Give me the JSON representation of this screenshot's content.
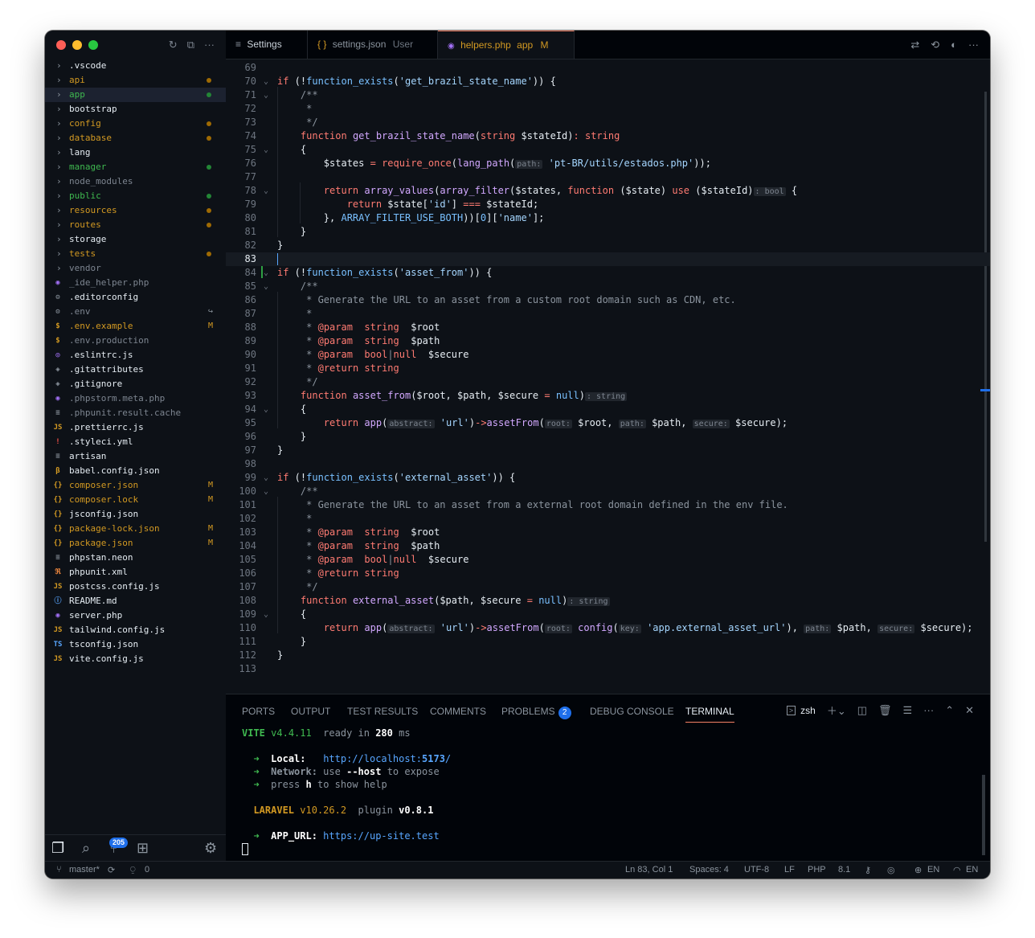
{
  "tabs": [
    {
      "icon": "≡",
      "label": "Settings",
      "desc": ""
    },
    {
      "icon": "{ }",
      "label": "settings.json",
      "desc": "User"
    },
    {
      "icon": "php",
      "label": "helpers.php",
      "desc": "app",
      "status": "M"
    }
  ],
  "sidebar": {
    "items": [
      {
        "label": ".vscode",
        "type": "folder",
        "color": "#e6edf3",
        "mark": ""
      },
      {
        "label": "api",
        "type": "folder",
        "color": "#d29922",
        "mark": "dot-yellow"
      },
      {
        "label": "app",
        "type": "folder",
        "color": "#3fb950",
        "mark": "dot-green",
        "selected": true
      },
      {
        "label": "bootstrap",
        "type": "folder",
        "color": "#e6edf3",
        "mark": ""
      },
      {
        "label": "config",
        "type": "folder",
        "color": "#d29922",
        "mark": "dot-yellow"
      },
      {
        "label": "database",
        "type": "folder",
        "color": "#d29922",
        "mark": "dot-yellow"
      },
      {
        "label": "lang",
        "type": "folder",
        "color": "#e6edf3",
        "mark": ""
      },
      {
        "label": "manager",
        "type": "folder",
        "color": "#3fb950",
        "mark": "dot-green"
      },
      {
        "label": "node_modules",
        "type": "folder",
        "color": "#7d8590",
        "mark": ""
      },
      {
        "label": "public",
        "type": "folder",
        "color": "#3fb950",
        "mark": "dot-green"
      },
      {
        "label": "resources",
        "type": "folder",
        "color": "#d29922",
        "mark": "dot-yellow"
      },
      {
        "label": "routes",
        "type": "folder",
        "color": "#d29922",
        "mark": "dot-yellow"
      },
      {
        "label": "storage",
        "type": "folder",
        "color": "#e6edf3",
        "mark": ""
      },
      {
        "label": "tests",
        "type": "folder",
        "color": "#d29922",
        "mark": "dot-yellow"
      },
      {
        "label": "vendor",
        "type": "folder",
        "color": "#7d8590",
        "mark": ""
      },
      {
        "label": "_ide_helper.php",
        "type": "file",
        "icon": "php",
        "color": "#7d8590",
        "mark": ""
      },
      {
        "label": ".editorconfig",
        "type": "file",
        "icon": "gear",
        "color": "#e6edf3",
        "mark": ""
      },
      {
        "label": ".env",
        "type": "file",
        "icon": "gear",
        "color": "#7d8590",
        "mark": "arrow"
      },
      {
        "label": ".env.example",
        "type": "file",
        "icon": "$",
        "color": "#d29922",
        "mark": "M"
      },
      {
        "label": ".env.production",
        "type": "file",
        "icon": "$",
        "color": "#7d8590",
        "mark": ""
      },
      {
        "label": ".eslintrc.js",
        "type": "file",
        "icon": "eslint",
        "color": "#e6edf3",
        "mark": ""
      },
      {
        "label": ".gitattributes",
        "type": "file",
        "icon": "git",
        "color": "#e6edf3",
        "mark": ""
      },
      {
        "label": ".gitignore",
        "type": "file",
        "icon": "git",
        "color": "#e6edf3",
        "mark": ""
      },
      {
        "label": ".phpstorm.meta.php",
        "type": "file",
        "icon": "php",
        "color": "#7d8590",
        "mark": ""
      },
      {
        "label": ".phpunit.result.cache",
        "type": "file",
        "icon": "lines",
        "color": "#7d8590",
        "mark": ""
      },
      {
        "label": ".prettierrc.js",
        "type": "file",
        "icon": "JS",
        "color": "#e6edf3",
        "mark": ""
      },
      {
        "label": ".styleci.yml",
        "type": "file",
        "icon": "!",
        "color": "#e6edf3",
        "mark": ""
      },
      {
        "label": "artisan",
        "type": "file",
        "icon": "lines",
        "color": "#e6edf3",
        "mark": ""
      },
      {
        "label": "babel.config.json",
        "type": "file",
        "icon": "babel",
        "color": "#e6edf3",
        "mark": ""
      },
      {
        "label": "composer.json",
        "type": "file",
        "icon": "{}",
        "color": "#d29922",
        "mark": "M"
      },
      {
        "label": "composer.lock",
        "type": "file",
        "icon": "{}",
        "color": "#d29922",
        "mark": "M"
      },
      {
        "label": "jsconfig.json",
        "type": "file",
        "icon": "{}",
        "color": "#e6edf3",
        "mark": ""
      },
      {
        "label": "package-lock.json",
        "type": "file",
        "icon": "{}",
        "color": "#d29922",
        "mark": "M"
      },
      {
        "label": "package.json",
        "type": "file",
        "icon": "{}",
        "color": "#d29922",
        "mark": "M"
      },
      {
        "label": "phpstan.neon",
        "type": "file",
        "icon": "lines",
        "color": "#e6edf3",
        "mark": ""
      },
      {
        "label": "phpunit.xml",
        "type": "file",
        "icon": "rss",
        "color": "#e6edf3",
        "mark": ""
      },
      {
        "label": "postcss.config.js",
        "type": "file",
        "icon": "JS",
        "color": "#e6edf3",
        "mark": ""
      },
      {
        "label": "README.md",
        "type": "file",
        "icon": "info",
        "color": "#e6edf3",
        "mark": ""
      },
      {
        "label": "server.php",
        "type": "file",
        "icon": "php",
        "color": "#e6edf3",
        "mark": ""
      },
      {
        "label": "tailwind.config.js",
        "type": "file",
        "icon": "JS",
        "color": "#e6edf3",
        "mark": ""
      },
      {
        "label": "tsconfig.json",
        "type": "file",
        "icon": "TS",
        "color": "#e6edf3",
        "mark": ""
      },
      {
        "label": "vite.config.js",
        "type": "file",
        "icon": "JS",
        "color": "#e6edf3",
        "mark": ""
      }
    ],
    "scm_badge": "205"
  },
  "editor": {
    "current_line": 83,
    "lines": [
      {
        "n": 69,
        "html": ""
      },
      {
        "n": 70,
        "fold": true,
        "html": "<span class='kw'>if</span> (!<span class='ct'>function_exists</span>(<span class='st'>'get_brazil_state_name'</span>)) {"
      },
      {
        "n": 71,
        "fold": true,
        "html": "    <span class='cm'>/**</span>"
      },
      {
        "n": 72,
        "html": "    <span class='cm'> *</span>"
      },
      {
        "n": 73,
        "html": "    <span class='cm'> */</span>"
      },
      {
        "n": 74,
        "html": "    <span class='kw'>function</span> <span class='fn'>get_brazil_state_name</span>(<span class='kw'>string</span> <span class='pl'>$stateId</span>)<span class='kw'>:</span> <span class='kw'>string</span>"
      },
      {
        "n": 75,
        "fold": true,
        "html": "    {"
      },
      {
        "n": 76,
        "html": "        <span class='pl'>$states</span> <span class='kw'>=</span> <span class='kw'>require_once</span>(<span class='fn'>lang_path</span>(<span class='hint'>path:</span> <span class='st'>'pt-BR/utils/estados.php'</span>));"
      },
      {
        "n": 77,
        "html": ""
      },
      {
        "n": 78,
        "fold": true,
        "html": "        <span class='kw'>return</span> <span class='fn'>array_values</span>(<span class='fn'>array_filter</span>(<span class='pl'>$states</span>, <span class='kw'>function</span> (<span class='pl'>$state</span>) <span class='kw'>use</span> (<span class='pl'>$stateId</span>)<span class='hint'>: bool</span> {"
      },
      {
        "n": 79,
        "html": "            <span class='kw'>return</span> <span class='pl'>$state</span>[<span class='st'>'id'</span>] <span class='kw'>===</span> <span class='pl'>$stateId</span>;"
      },
      {
        "n": 80,
        "html": "        }, <span class='ct'>ARRAY_FILTER_USE_BOTH</span>))[<span class='ct'>0</span>][<span class='st'>'name'</span>];"
      },
      {
        "n": 81,
        "html": "    }"
      },
      {
        "n": 82,
        "html": "}"
      },
      {
        "n": 83,
        "html": ""
      },
      {
        "n": 84,
        "fold": true,
        "html": "<span class='kw'>if</span> (!<span class='ct'>function_exists</span>(<span class='st'>'asset_from'</span>)) {"
      },
      {
        "n": 85,
        "fold": true,
        "html": "    <span class='cm'>/**</span>"
      },
      {
        "n": 86,
        "html": "    <span class='cm'> * Generate the URL to an asset from a custom root domain such as CDN, etc.</span>"
      },
      {
        "n": 87,
        "html": "    <span class='cm'> *</span>"
      },
      {
        "n": 88,
        "html": "    <span class='cm'> * </span><span class='kw'>@param</span>  <span class='kw'>string</span>  <span class='pl'>$root</span>"
      },
      {
        "n": 89,
        "html": "    <span class='cm'> * </span><span class='kw'>@param</span>  <span class='kw'>string</span>  <span class='pl'>$path</span>"
      },
      {
        "n": 90,
        "html": "    <span class='cm'> * </span><span class='kw'>@param</span>  <span class='kw'>bool</span><span class='cm'>|</span><span class='kw'>null</span>  <span class='pl'>$secure</span>"
      },
      {
        "n": 91,
        "html": "    <span class='cm'> * </span><span class='kw'>@return</span> <span class='kw'>string</span>"
      },
      {
        "n": 92,
        "html": "    <span class='cm'> */</span>"
      },
      {
        "n": 93,
        "html": "    <span class='kw'>function</span> <span class='fn'>asset_from</span>(<span class='pl'>$root</span>, <span class='pl'>$path</span>, <span class='pl'>$secure</span> <span class='kw'>=</span> <span class='ct'>null</span>)<span class='hint'>: string</span>"
      },
      {
        "n": 94,
        "fold": true,
        "html": "    {"
      },
      {
        "n": 95,
        "html": "        <span class='kw'>return</span> <span class='fn'>app</span>(<span class='hint'>abstract:</span> <span class='st'>'url'</span>)<span class='kw'>-></span><span class='fn'>assetFrom</span>(<span class='hint'>root:</span> <span class='pl'>$root</span>, <span class='hint'>path:</span> <span class='pl'>$path</span>, <span class='hint'>secure:</span> <span class='pl'>$secure</span>);"
      },
      {
        "n": 96,
        "html": "    }"
      },
      {
        "n": 97,
        "html": "}"
      },
      {
        "n": 98,
        "html": ""
      },
      {
        "n": 99,
        "fold": true,
        "html": "<span class='kw'>if</span> (!<span class='ct'>function_exists</span>(<span class='st'>'external_asset'</span>)) {"
      },
      {
        "n": 100,
        "fold": true,
        "html": "    <span class='cm'>/**</span>"
      },
      {
        "n": 101,
        "html": "    <span class='cm'> * Generate the URL to an asset from a external root domain defined in the env file.</span>"
      },
      {
        "n": 102,
        "html": "    <span class='cm'> *</span>"
      },
      {
        "n": 103,
        "html": "    <span class='cm'> * </span><span class='kw'>@param</span>  <span class='kw'>string</span>  <span class='pl'>$root</span>"
      },
      {
        "n": 104,
        "html": "    <span class='cm'> * </span><span class='kw'>@param</span>  <span class='kw'>string</span>  <span class='pl'>$path</span>"
      },
      {
        "n": 105,
        "html": "    <span class='cm'> * </span><span class='kw'>@param</span>  <span class='kw'>bool</span><span class='cm'>|</span><span class='kw'>null</span>  <span class='pl'>$secure</span>"
      },
      {
        "n": 106,
        "html": "    <span class='cm'> * </span><span class='kw'>@return</span> <span class='kw'>string</span>"
      },
      {
        "n": 107,
        "html": "    <span class='cm'> */</span>"
      },
      {
        "n": 108,
        "html": "    <span class='kw'>function</span> <span class='fn'>external_asset</span>(<span class='pl'>$path</span>, <span class='pl'>$secure</span> <span class='kw'>=</span> <span class='ct'>null</span>)<span class='hint'>: string</span>"
      },
      {
        "n": 109,
        "fold": true,
        "html": "    {"
      },
      {
        "n": 110,
        "html": "        <span class='kw'>return</span> <span class='fn'>app</span>(<span class='hint'>abstract:</span> <span class='st'>'url'</span>)<span class='kw'>-></span><span class='fn'>assetFrom</span>(<span class='hint'>root:</span> <span class='fn'>config</span>(<span class='hint'>key:</span> <span class='st'>'app.external_asset_url'</span>), <span class='hint'>path:</span> <span class='pl'>$path</span>, <span class='hint'>secure:</span> <span class='pl'>$secure</span>);"
      },
      {
        "n": 111,
        "html": "    }"
      },
      {
        "n": 112,
        "html": "}"
      },
      {
        "n": 113,
        "html": ""
      }
    ]
  },
  "panel": {
    "tabs": [
      "PORTS",
      "OUTPUT",
      "TEST RESULTS",
      "COMMENTS",
      "PROBLEMS",
      "DEBUG CONSOLE",
      "TERMINAL"
    ],
    "problems_count": "2",
    "shell": "zsh",
    "terminal": {
      "vite": "VITE",
      "vite_version": "v4.4.11",
      "ready": "ready in",
      "ready_ms": "280",
      "ms": "ms",
      "local_label": "Local:",
      "local_url_prefix": "http://localhost:",
      "local_port": "5173",
      "local_url_suffix": "/",
      "network_label": "Network:",
      "network_use": "use",
      "network_host": "--host",
      "network_expose": "to expose",
      "press": "press",
      "press_key": "h",
      "press_rest": "to show help",
      "laravel": "LARAVEL",
      "laravel_version": "v10.26.2",
      "plugin": "plugin",
      "plugin_version": "v0.8.1",
      "app_url_label": "APP_URL:",
      "app_url": "https://up-site.test"
    }
  },
  "status": {
    "branch": "master*",
    "ports": "0",
    "position": "Ln 83, Col 1",
    "spaces": "Spaces: 4",
    "encoding": "UTF-8",
    "eol": "LF",
    "language": "PHP",
    "version": "8.1",
    "locale": "EN",
    "locale2": "EN"
  }
}
